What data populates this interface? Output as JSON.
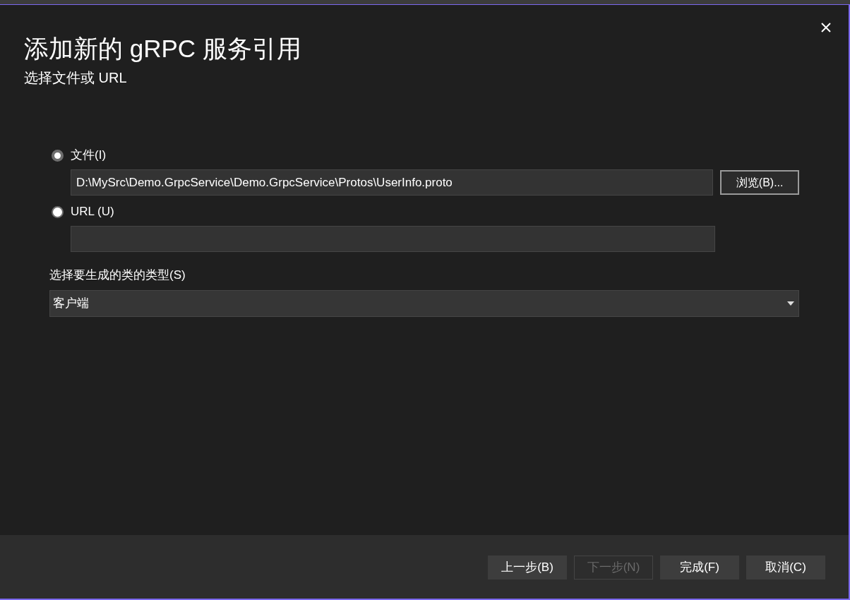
{
  "dialog": {
    "title": "添加新的 gRPC 服务引用",
    "subtitle": "选择文件或 URL"
  },
  "sources": [
    {
      "label": "文件(I)",
      "selected": true,
      "value": "D:\\MySrc\\Demo.GrpcService\\Demo.GrpcService\\Protos\\UserInfo.proto",
      "browse": "浏览(B)..."
    },
    {
      "label": "URL (U)",
      "selected": false
    }
  ],
  "class_type": {
    "label": "选择要生成的类的类型(S)",
    "value": "客户端"
  },
  "buttons": [
    {
      "label": "上一步(B)",
      "disabled": false
    },
    {
      "label": "下一步(N)",
      "disabled": true
    },
    {
      "label": "完成(F)",
      "disabled": false
    },
    {
      "label": "取消(C)",
      "disabled": false
    }
  ]
}
